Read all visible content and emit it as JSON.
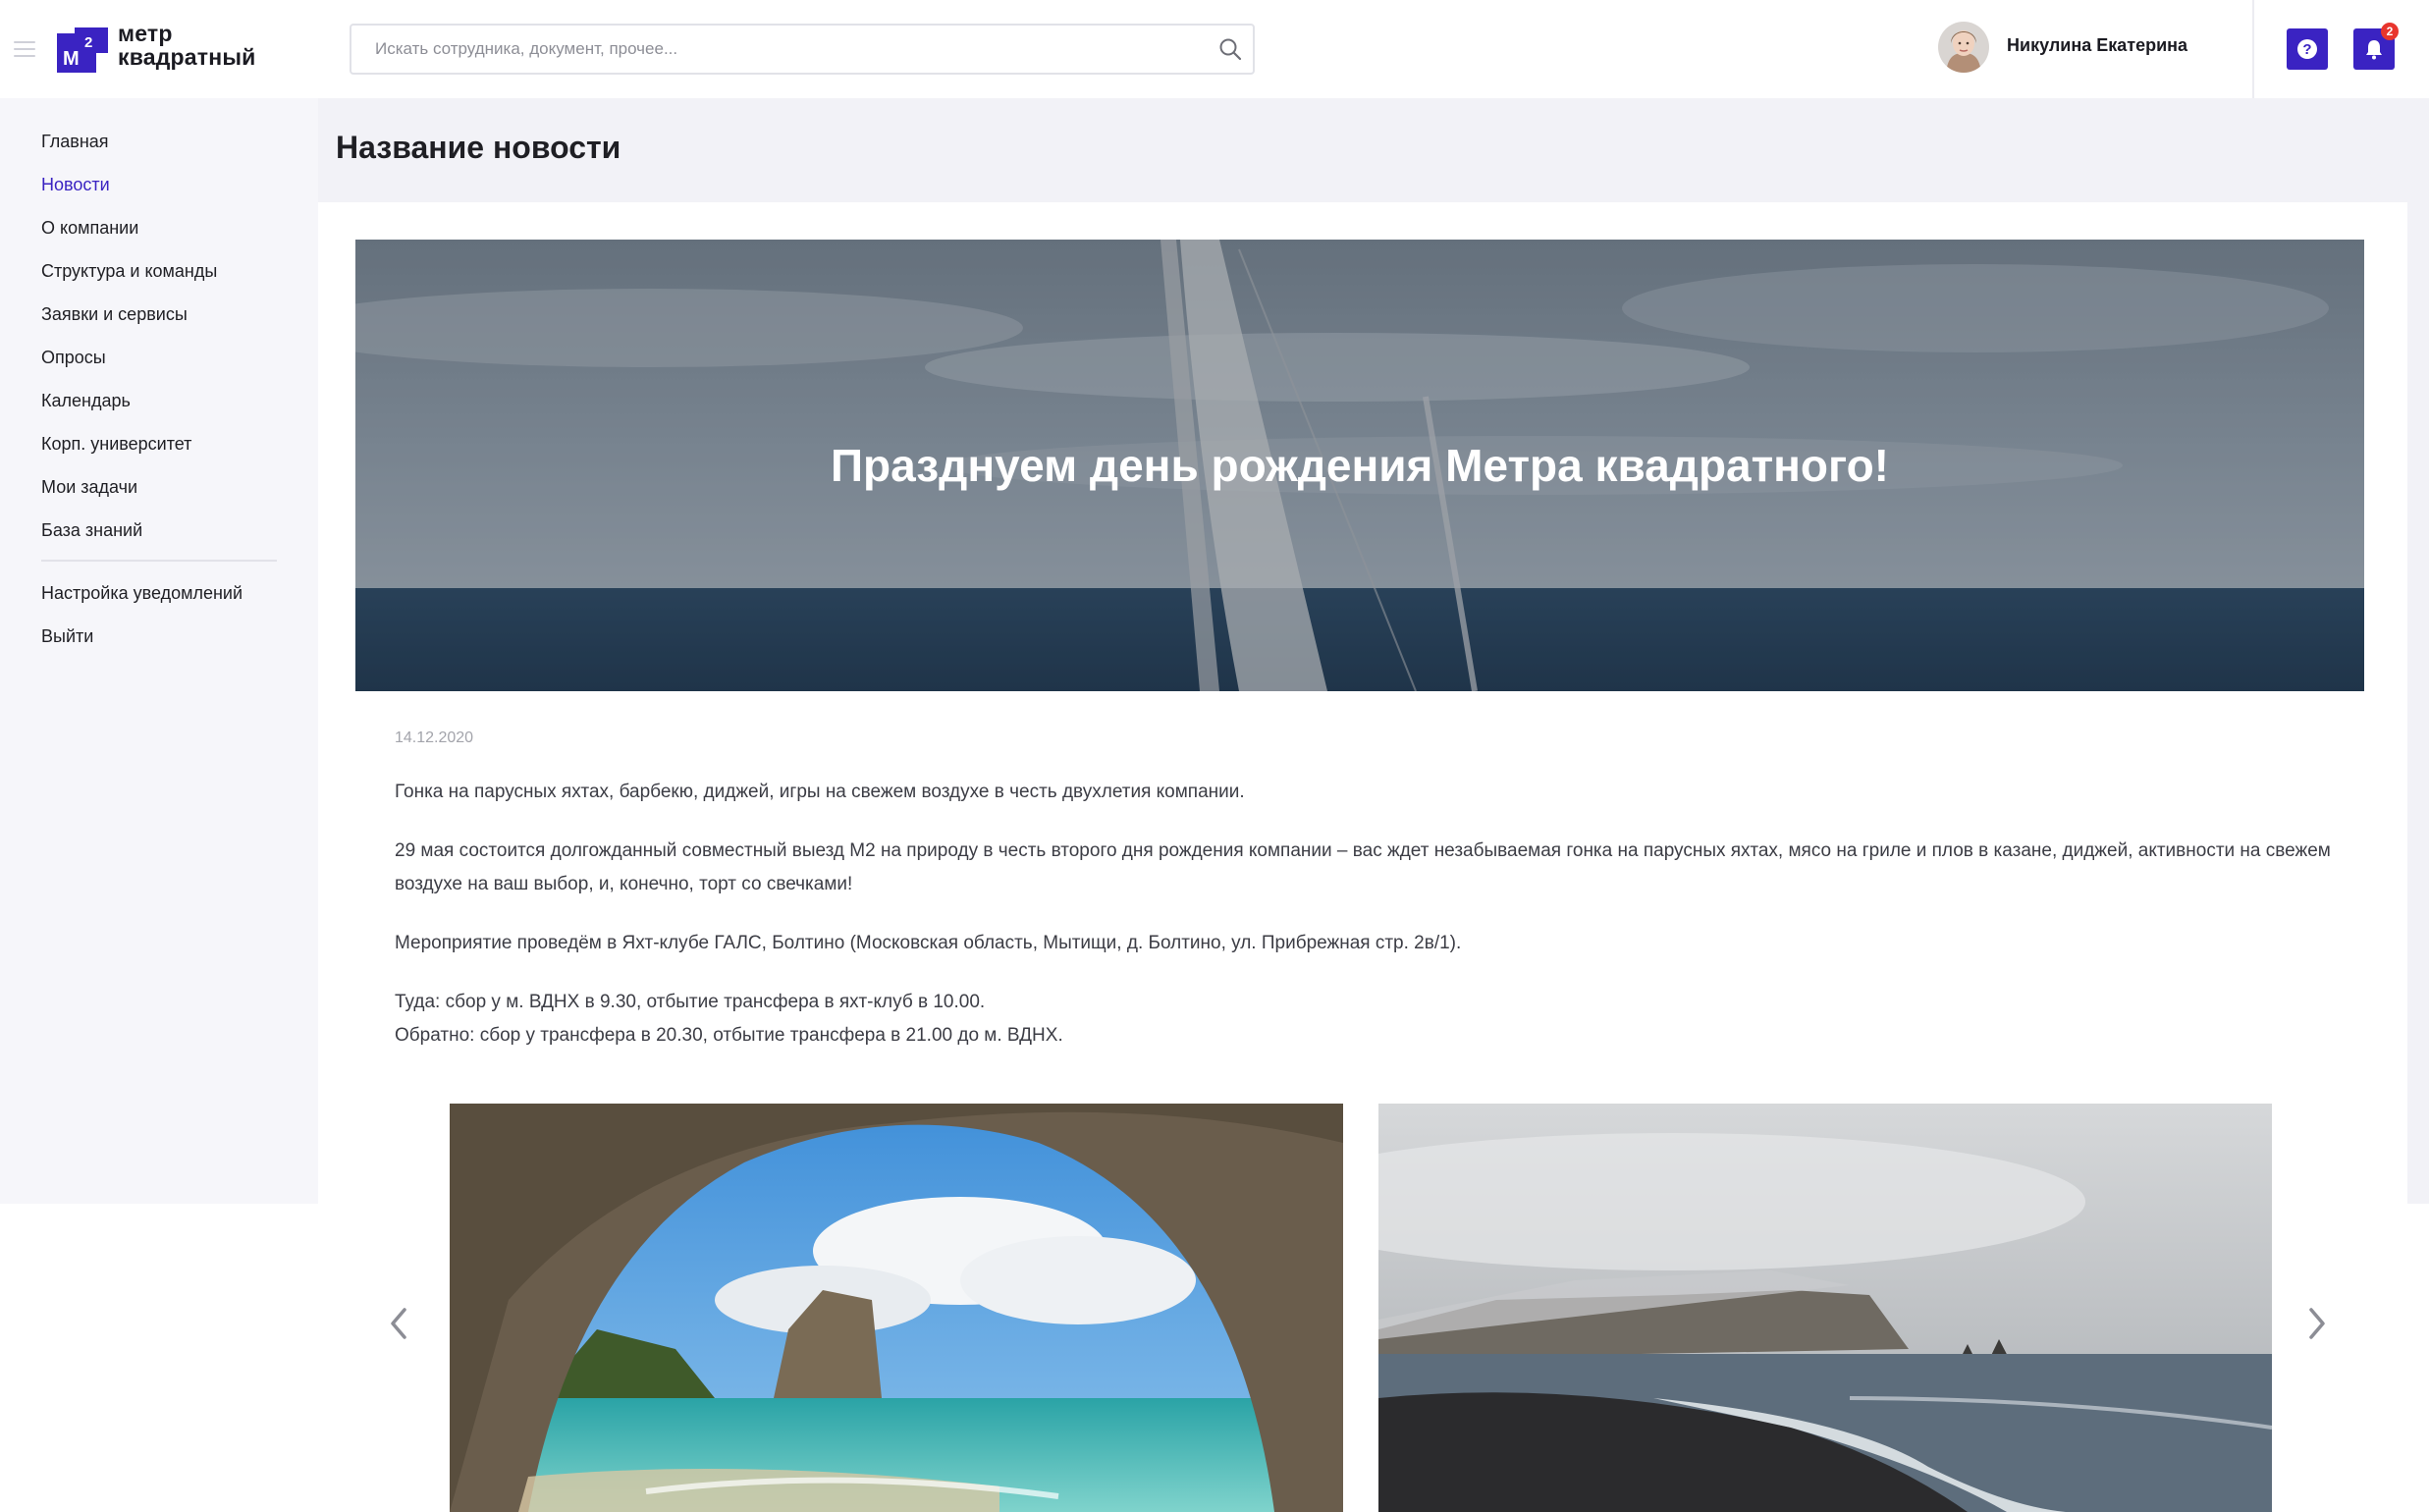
{
  "header": {
    "logo_line1": "метр",
    "logo_line2": "квадратный",
    "logo_mark_text": "M",
    "logo_mark_sup": "2",
    "search_placeholder": "Искать сотрудника, документ, прочее...",
    "user_name": "Никулина Екатерина",
    "notifications_count": "2",
    "help_symbol": "?"
  },
  "sidebar": {
    "items": [
      {
        "label": "Главная",
        "active": false
      },
      {
        "label": "Новости",
        "active": true
      },
      {
        "label": "О компании",
        "active": false
      },
      {
        "label": "Структура и команды",
        "active": false
      },
      {
        "label": "Заявки и сервисы",
        "active": false
      },
      {
        "label": "Опросы",
        "active": false
      },
      {
        "label": "Календарь",
        "active": false
      },
      {
        "label": "Корп. университет",
        "active": false
      },
      {
        "label": "Мои задачи",
        "active": false
      },
      {
        "label": "База знаний",
        "active": false
      }
    ],
    "secondary_items": [
      {
        "label": "Настройка уведомлений"
      },
      {
        "label": "Выйти"
      }
    ]
  },
  "page": {
    "title": "Название новости"
  },
  "news": {
    "hero_title": "Празднуем день рождения Метра квадратного!",
    "date": "14.12.2020",
    "paragraphs": [
      "Гонка на парусных яхтах, барбекю, диджей, игры на свежем воздухе в честь двухлетия компании.",
      "29 мая состоится долгожданный совместный выезд М2 на природу в честь второго дня рождения компании – вас ждет незабываемая гонка на парусных яхтах, мясо на гриле и плов в казане, диджей, активности на свежем воздухе на ваш выбор, и, конечно, торт со свечками!",
      "Мероприятие проведём в Яхт-клубе ГАЛС, Болтино (Московская область, Мытищи, д. Болтино, ул. Прибрежная стр. 2в/1)."
    ],
    "schedule_line1": "Туда: сбор у м. ВДНХ в 9.30, отбытие трансфера в яхт-клуб в 10.00.",
    "schedule_line2": "Обратно: сбор у трансфера в 20.30, отбытие трансфера в 21.00 до м. ВДНХ."
  },
  "gallery": {
    "prev_icon": "chevron-left-icon",
    "next_icon": "chevron-right-icon"
  },
  "colors": {
    "accent": "#3a23c2",
    "badge": "#e8352d",
    "page_bg": "#f2f2f7"
  }
}
